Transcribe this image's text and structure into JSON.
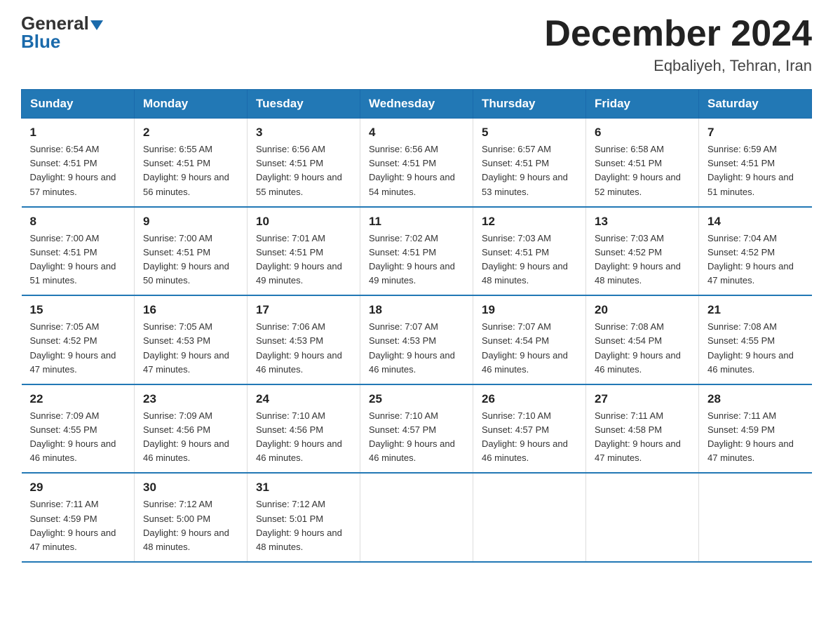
{
  "header": {
    "logo_general": "General",
    "logo_blue": "Blue",
    "month_title": "December 2024",
    "location": "Eqbaliyeh, Tehran, Iran"
  },
  "weekdays": [
    "Sunday",
    "Monday",
    "Tuesday",
    "Wednesday",
    "Thursday",
    "Friday",
    "Saturday"
  ],
  "weeks": [
    [
      {
        "day": "1",
        "sunrise": "6:54 AM",
        "sunset": "4:51 PM",
        "daylight": "9 hours and 57 minutes."
      },
      {
        "day": "2",
        "sunrise": "6:55 AM",
        "sunset": "4:51 PM",
        "daylight": "9 hours and 56 minutes."
      },
      {
        "day": "3",
        "sunrise": "6:56 AM",
        "sunset": "4:51 PM",
        "daylight": "9 hours and 55 minutes."
      },
      {
        "day": "4",
        "sunrise": "6:56 AM",
        "sunset": "4:51 PM",
        "daylight": "9 hours and 54 minutes."
      },
      {
        "day": "5",
        "sunrise": "6:57 AM",
        "sunset": "4:51 PM",
        "daylight": "9 hours and 53 minutes."
      },
      {
        "day": "6",
        "sunrise": "6:58 AM",
        "sunset": "4:51 PM",
        "daylight": "9 hours and 52 minutes."
      },
      {
        "day": "7",
        "sunrise": "6:59 AM",
        "sunset": "4:51 PM",
        "daylight": "9 hours and 51 minutes."
      }
    ],
    [
      {
        "day": "8",
        "sunrise": "7:00 AM",
        "sunset": "4:51 PM",
        "daylight": "9 hours and 51 minutes."
      },
      {
        "day": "9",
        "sunrise": "7:00 AM",
        "sunset": "4:51 PM",
        "daylight": "9 hours and 50 minutes."
      },
      {
        "day": "10",
        "sunrise": "7:01 AM",
        "sunset": "4:51 PM",
        "daylight": "9 hours and 49 minutes."
      },
      {
        "day": "11",
        "sunrise": "7:02 AM",
        "sunset": "4:51 PM",
        "daylight": "9 hours and 49 minutes."
      },
      {
        "day": "12",
        "sunrise": "7:03 AM",
        "sunset": "4:51 PM",
        "daylight": "9 hours and 48 minutes."
      },
      {
        "day": "13",
        "sunrise": "7:03 AM",
        "sunset": "4:52 PM",
        "daylight": "9 hours and 48 minutes."
      },
      {
        "day": "14",
        "sunrise": "7:04 AM",
        "sunset": "4:52 PM",
        "daylight": "9 hours and 47 minutes."
      }
    ],
    [
      {
        "day": "15",
        "sunrise": "7:05 AM",
        "sunset": "4:52 PM",
        "daylight": "9 hours and 47 minutes."
      },
      {
        "day": "16",
        "sunrise": "7:05 AM",
        "sunset": "4:53 PM",
        "daylight": "9 hours and 47 minutes."
      },
      {
        "day": "17",
        "sunrise": "7:06 AM",
        "sunset": "4:53 PM",
        "daylight": "9 hours and 46 minutes."
      },
      {
        "day": "18",
        "sunrise": "7:07 AM",
        "sunset": "4:53 PM",
        "daylight": "9 hours and 46 minutes."
      },
      {
        "day": "19",
        "sunrise": "7:07 AM",
        "sunset": "4:54 PM",
        "daylight": "9 hours and 46 minutes."
      },
      {
        "day": "20",
        "sunrise": "7:08 AM",
        "sunset": "4:54 PM",
        "daylight": "9 hours and 46 minutes."
      },
      {
        "day": "21",
        "sunrise": "7:08 AM",
        "sunset": "4:55 PM",
        "daylight": "9 hours and 46 minutes."
      }
    ],
    [
      {
        "day": "22",
        "sunrise": "7:09 AM",
        "sunset": "4:55 PM",
        "daylight": "9 hours and 46 minutes."
      },
      {
        "day": "23",
        "sunrise": "7:09 AM",
        "sunset": "4:56 PM",
        "daylight": "9 hours and 46 minutes."
      },
      {
        "day": "24",
        "sunrise": "7:10 AM",
        "sunset": "4:56 PM",
        "daylight": "9 hours and 46 minutes."
      },
      {
        "day": "25",
        "sunrise": "7:10 AM",
        "sunset": "4:57 PM",
        "daylight": "9 hours and 46 minutes."
      },
      {
        "day": "26",
        "sunrise": "7:10 AM",
        "sunset": "4:57 PM",
        "daylight": "9 hours and 46 minutes."
      },
      {
        "day": "27",
        "sunrise": "7:11 AM",
        "sunset": "4:58 PM",
        "daylight": "9 hours and 47 minutes."
      },
      {
        "day": "28",
        "sunrise": "7:11 AM",
        "sunset": "4:59 PM",
        "daylight": "9 hours and 47 minutes."
      }
    ],
    [
      {
        "day": "29",
        "sunrise": "7:11 AM",
        "sunset": "4:59 PM",
        "daylight": "9 hours and 47 minutes."
      },
      {
        "day": "30",
        "sunrise": "7:12 AM",
        "sunset": "5:00 PM",
        "daylight": "9 hours and 48 minutes."
      },
      {
        "day": "31",
        "sunrise": "7:12 AM",
        "sunset": "5:01 PM",
        "daylight": "9 hours and 48 minutes."
      },
      null,
      null,
      null,
      null
    ]
  ]
}
